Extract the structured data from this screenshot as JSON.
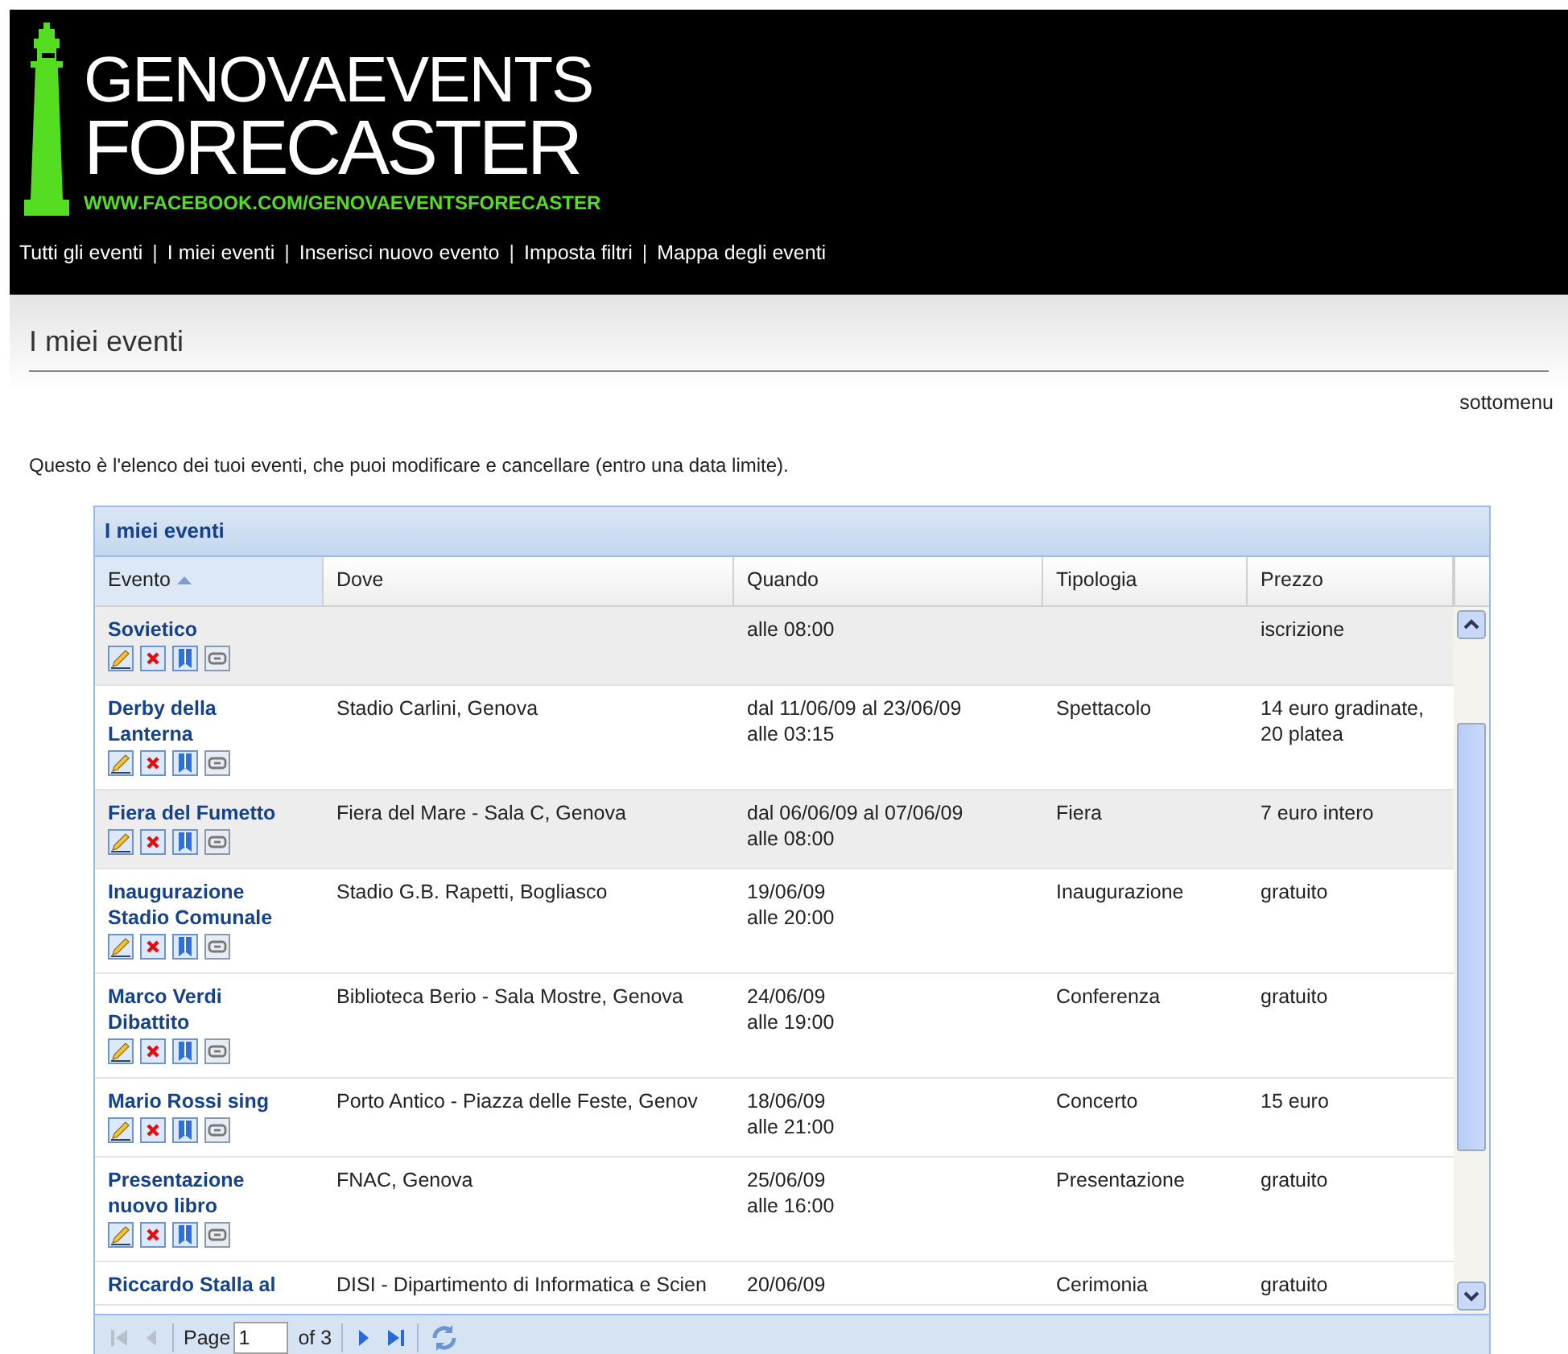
{
  "header": {
    "logo_line_1": "GENOVAEVENTS",
    "logo_line_2": "FORECASTER",
    "logo_url": "WWW.FACEBOOK.COM/GENOVAEVENTSFORECASTER",
    "nav": [
      {
        "kind": "link",
        "label": "Tutti gli eventi"
      },
      {
        "kind": "separator",
        "label": "|"
      },
      {
        "kind": "link",
        "label": "I miei eventi"
      },
      {
        "kind": "separator",
        "label": "|"
      },
      {
        "kind": "link",
        "label": "Inserisci nuovo evento"
      },
      {
        "kind": "separator",
        "label": "|"
      },
      {
        "kind": "link",
        "label": "Imposta filtri"
      },
      {
        "kind": "separator",
        "label": "|"
      },
      {
        "kind": "link",
        "label": "Mappa degli eventi"
      }
    ]
  },
  "page_title": "I miei eventi",
  "submenu": "sottomenu",
  "description": "Questo è l'elenco dei tuoi eventi, che puoi modificare e cancellare (entro una data limite).",
  "grid": {
    "title": "I miei eventi",
    "columns": [
      {
        "label": "Evento",
        "sorted": true
      },
      {
        "label": "Dove",
        "sorted": false
      },
      {
        "label": "Quando",
        "sorted": false
      },
      {
        "label": "Tipologia",
        "sorted": false
      },
      {
        "label": "Prezzo",
        "sorted": false
      }
    ],
    "rows": [
      {
        "evento": "Sovietico",
        "dove": "",
        "quando": "alle 08:00",
        "tipologia": "",
        "prezzo": "iscrizione",
        "selected": true,
        "actions": true
      },
      {
        "evento": "Derby della Lanterna",
        "dove": "Stadio Carlini, Genova",
        "quando": "dal 11/06/09 al 23/06/09\nalle 03:15",
        "tipologia": "Spettacolo",
        "prezzo": "14 euro gradinate, 20 platea",
        "selected": false,
        "actions": true
      },
      {
        "evento": "Fiera del Fumetto",
        "dove": "Fiera del Mare - Sala C, Genova",
        "quando": "dal 06/06/09 al 07/06/09\nalle 08:00",
        "tipologia": "Fiera",
        "prezzo": "7 euro intero",
        "selected": true,
        "actions": true
      },
      {
        "evento": "Inaugurazione Stadio Comunale",
        "dove": "Stadio G.B. Rapetti, Bogliasco",
        "quando": "19/06/09\nalle 20:00",
        "tipologia": "Inaugurazione",
        "prezzo": "gratuito",
        "selected": false,
        "actions": true
      },
      {
        "evento": "Marco Verdi Dibattito",
        "dove": "Biblioteca Berio - Sala Mostre, Genova",
        "quando": "24/06/09\nalle 19:00",
        "tipologia": "Conferenza",
        "prezzo": "gratuito",
        "selected": false,
        "actions": true
      },
      {
        "evento": "Mario Rossi sing",
        "dove": "Porto Antico - Piazza delle Feste, Genov",
        "quando": "18/06/09\nalle 21:00",
        "tipologia": "Concerto",
        "prezzo": "15 euro",
        "selected": false,
        "actions": true
      },
      {
        "evento": "Presentazione nuovo libro",
        "dove": "FNAC, Genova",
        "quando": "25/06/09\nalle 16:00",
        "tipologia": "Presentazione",
        "prezzo": "gratuito",
        "selected": false,
        "actions": true
      },
      {
        "evento": "Riccardo Stalla al",
        "dove": "DISI - Dipartimento di Informatica e Scien",
        "quando": "20/06/09",
        "tipologia": "Cerimonia",
        "prezzo": "gratuito",
        "selected": false,
        "actions": false
      }
    ],
    "pager": {
      "page_label": "Page",
      "page_value": "1",
      "of_label": "of 3",
      "first_disabled": true,
      "prev_disabled": true,
      "next_disabled": false,
      "last_disabled": false
    }
  }
}
